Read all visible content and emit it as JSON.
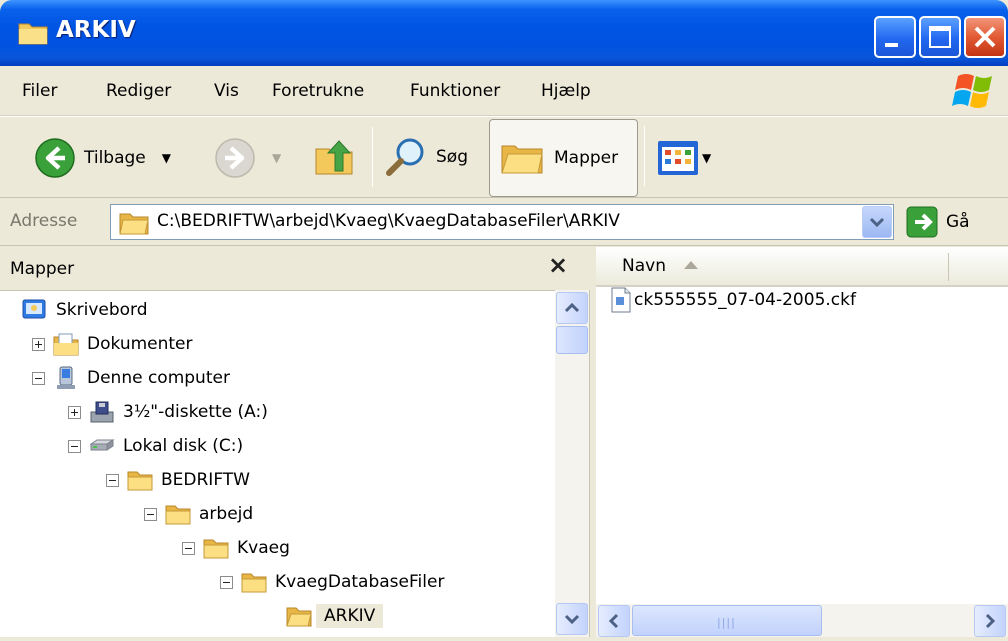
{
  "window": {
    "title": "ARKIV"
  },
  "menu": [
    "Filer",
    "Rediger",
    "Vis",
    "Foretrukne",
    "Funktioner",
    "Hjælp"
  ],
  "toolbar": {
    "back_label": "Tilbage",
    "search_label": "Søg",
    "folders_label": "Mapper"
  },
  "address": {
    "label": "Adresse",
    "value": "C:\\BEDRIFTW\\arbejd\\Kvaeg\\KvaegDatabaseFiler\\ARKIV",
    "go_label": "Gå"
  },
  "folders_pane": {
    "title": "Mapper",
    "close": "×",
    "tree": [
      {
        "label": "Skrivebord",
        "icon": "desktop-icon",
        "depth": 0,
        "expander": "none"
      },
      {
        "label": "Dokumenter",
        "icon": "documents-folder-icon",
        "depth": 1,
        "expander": "plus"
      },
      {
        "label": "Denne computer",
        "icon": "computer-icon",
        "depth": 1,
        "expander": "minus"
      },
      {
        "label": "3½\"-diskette (A:)",
        "icon": "floppy-drive-icon",
        "depth": 2,
        "expander": "plus"
      },
      {
        "label": "Lokal disk (C:)",
        "icon": "hard-drive-icon",
        "depth": 2,
        "expander": "minus"
      },
      {
        "label": "BEDRIFTW",
        "icon": "folder-icon",
        "depth": 3,
        "expander": "minus"
      },
      {
        "label": "arbejd",
        "icon": "folder-icon",
        "depth": 4,
        "expander": "minus"
      },
      {
        "label": "Kvaeg",
        "icon": "folder-icon",
        "depth": 5,
        "expander": "minus"
      },
      {
        "label": "KvaegDatabaseFiler",
        "icon": "folder-icon",
        "depth": 6,
        "expander": "minus"
      },
      {
        "label": "ARKIV",
        "icon": "open-folder-icon",
        "depth": 7,
        "expander": "none",
        "selected": true
      }
    ]
  },
  "files_pane": {
    "column_name": "Navn",
    "files": [
      {
        "name": "ck555555_07-04-2005.ckf",
        "icon": "file-icon"
      }
    ]
  },
  "colors": {
    "titlebar": "#0054e3",
    "folder": "#f3c95b",
    "chrome": "#ece9d8"
  }
}
